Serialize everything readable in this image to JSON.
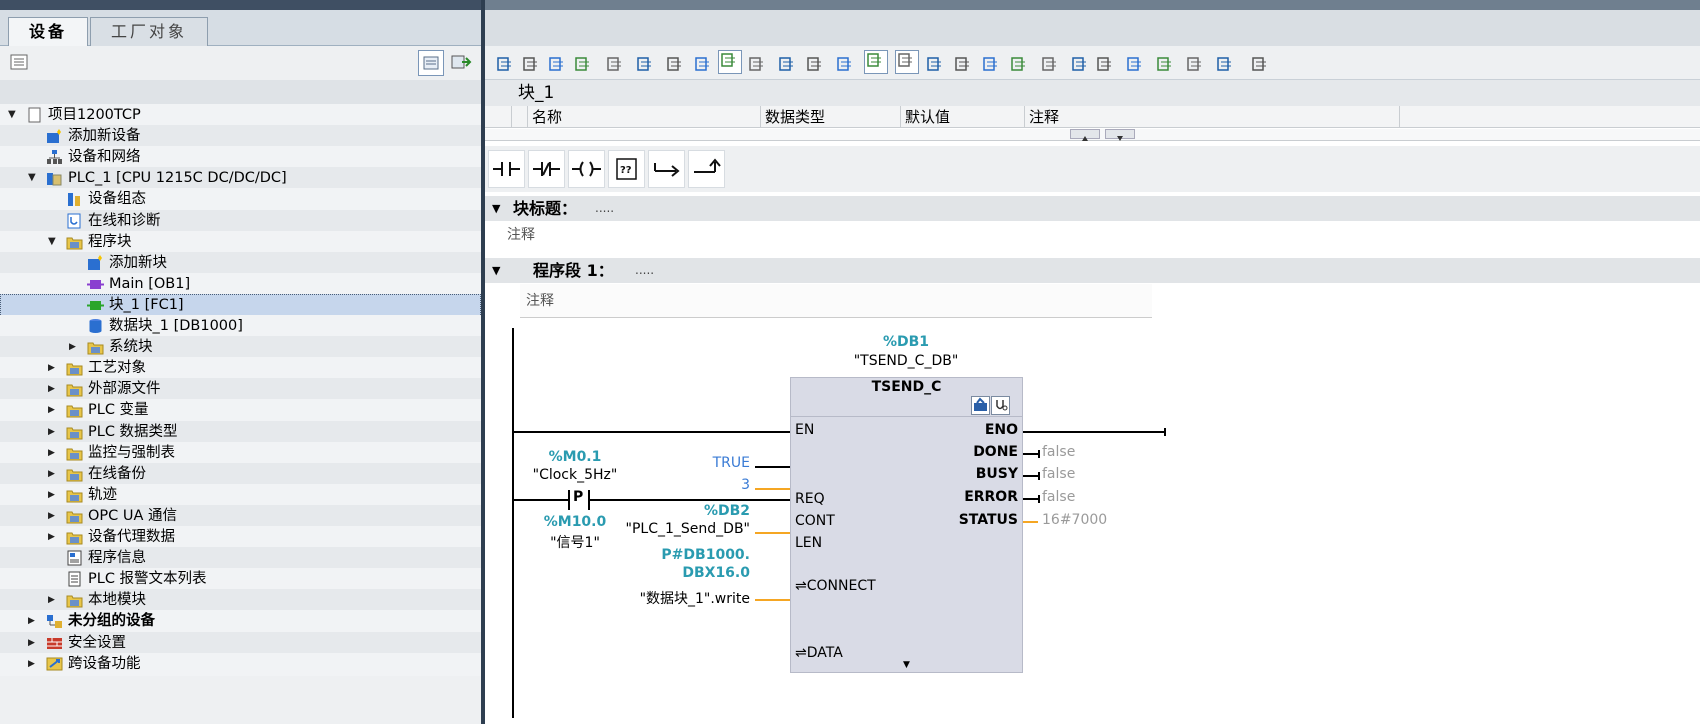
{
  "left_panel": {
    "tabs": [
      "设备",
      "工厂对象"
    ],
    "tree": [
      {
        "label": "项目1200TCP",
        "icon": "project-icon",
        "level": 0,
        "expand": "expanded",
        "bold": false
      },
      {
        "label": "添加新设备",
        "icon": "add-device-icon",
        "level": 1,
        "expand": "none",
        "bold": false
      },
      {
        "label": "设备和网络",
        "icon": "network-icon",
        "level": 1,
        "expand": "none",
        "bold": false
      },
      {
        "label": "PLC_1 [CPU 1215C DC/DC/DC]",
        "icon": "plc-icon",
        "level": 1,
        "expand": "expanded",
        "bold": false
      },
      {
        "label": "设备组态",
        "icon": "device-config-icon",
        "level": 2,
        "expand": "none",
        "bold": false
      },
      {
        "label": "在线和诊断",
        "icon": "diagnostics-icon",
        "level": 2,
        "expand": "none",
        "bold": false
      },
      {
        "label": "程序块",
        "icon": "folder-icon",
        "level": 2,
        "expand": "expanded",
        "bold": false
      },
      {
        "label": "添加新块",
        "icon": "add-block-icon",
        "level": 3,
        "expand": "none",
        "bold": false
      },
      {
        "label": "Main [OB1]",
        "icon": "ob-block-icon",
        "level": 3,
        "expand": "none",
        "bold": false
      },
      {
        "label": "块_1 [FC1]",
        "icon": "fc-block-icon",
        "level": 3,
        "expand": "none",
        "bold": false,
        "selected": true
      },
      {
        "label": "数据块_1 [DB1000]",
        "icon": "db-block-icon",
        "level": 3,
        "expand": "none",
        "bold": false
      },
      {
        "label": "系统块",
        "icon": "folder-icon",
        "level": 3,
        "expand": "collapsed",
        "bold": false
      },
      {
        "label": "工艺对象",
        "icon": "folder-icon",
        "level": 2,
        "expand": "collapsed",
        "bold": false
      },
      {
        "label": "外部源文件",
        "icon": "folder-icon",
        "level": 2,
        "expand": "collapsed",
        "bold": false
      },
      {
        "label": "PLC 变量",
        "icon": "folder-icon",
        "level": 2,
        "expand": "collapsed",
        "bold": false
      },
      {
        "label": "PLC 数据类型",
        "icon": "folder-icon",
        "level": 2,
        "expand": "collapsed",
        "bold": false
      },
      {
        "label": "监控与强制表",
        "icon": "folder-icon",
        "level": 2,
        "expand": "collapsed",
        "bold": false
      },
      {
        "label": "在线备份",
        "icon": "folder-icon",
        "level": 2,
        "expand": "collapsed",
        "bold": false
      },
      {
        "label": "轨迹",
        "icon": "folder-icon",
        "level": 2,
        "expand": "collapsed",
        "bold": false
      },
      {
        "label": "OPC UA 通信",
        "icon": "folder-icon",
        "level": 2,
        "expand": "collapsed",
        "bold": false
      },
      {
        "label": "设备代理数据",
        "icon": "folder-icon",
        "level": 2,
        "expand": "collapsed",
        "bold": false
      },
      {
        "label": "程序信息",
        "icon": "program-info-icon",
        "level": 2,
        "expand": "none",
        "bold": false
      },
      {
        "label": "PLC 报警文本列表",
        "icon": "alarm-text-icon",
        "level": 2,
        "expand": "none",
        "bold": false
      },
      {
        "label": "本地模块",
        "icon": "folder-icon",
        "level": 2,
        "expand": "collapsed",
        "bold": false
      },
      {
        "label": "未分组的设备",
        "icon": "ungrouped-devices-icon",
        "level": 1,
        "expand": "collapsed",
        "bold": true
      },
      {
        "label": "安全设置",
        "icon": "security-icon",
        "level": 1,
        "expand": "collapsed",
        "bold": false
      },
      {
        "label": "跨设备功能",
        "icon": "cross-device-icon",
        "level": 1,
        "expand": "collapsed",
        "bold": false
      }
    ]
  },
  "editor": {
    "block_name": "块_1",
    "interface_columns": [
      "名称",
      "数据类型",
      "默认值",
      "注释"
    ],
    "instructions": [
      "normally-open-contact",
      "normally-closed-contact",
      "coil",
      "empty-box",
      "open-branch",
      "close-branch"
    ],
    "block_title_label": "块标题：",
    "block_title_dots": ".....",
    "block_comment": "注释",
    "network_label": "程序段 1：",
    "network_dots": ".....",
    "network_comment": "注释",
    "lad": {
      "instance_address": "%DB1",
      "instance_name": "\"TSEND_C_DB\"",
      "fb_name": "TSEND_C",
      "pins_left": [
        "EN",
        "REQ",
        "CONT",
        "LEN",
        "⇌CONNECT",
        "⇌DATA"
      ],
      "pins_right": [
        "ENO",
        "DONE",
        "BUSY",
        "ERROR",
        "STATUS"
      ],
      "contact_operand_address": "%M0.1",
      "contact_operand_name": "\"Clock_5Hz\"",
      "contact_symbol": "P",
      "edge_memory_address": "%M10.0",
      "edge_memory_name": "\"信号1\"",
      "cont_value": "TRUE",
      "len_value": "3",
      "connect_address": "%DB2",
      "connect_name": "\"PLC_1_Send_DB\"",
      "data_address_line1": "P#DB1000.",
      "data_address_line2": "DBX16.0",
      "data_name": "\"数据块_1\".write",
      "done_value": "false",
      "busy_value": "false",
      "error_value": "false",
      "status_value": "16#7000"
    }
  },
  "colors": {
    "operand_teal": "#2a9bb0",
    "constant_blue": "#3a7bd5",
    "pin_orange": "#f5a623",
    "selected_row": "#c6d6ec",
    "fb_box": "#d9dbe6"
  }
}
